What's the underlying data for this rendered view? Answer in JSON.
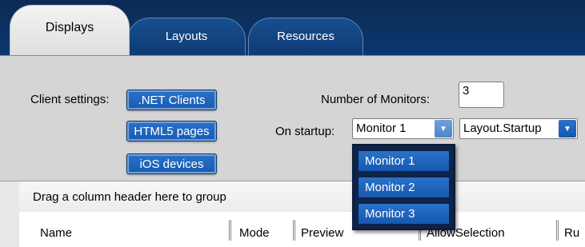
{
  "tabs": [
    {
      "label": "Displays",
      "active": true
    },
    {
      "label": "Layouts",
      "active": false
    },
    {
      "label": "Resources",
      "active": false
    }
  ],
  "client_settings": {
    "label": "Client settings:",
    "buttons": [
      ".NET Clients",
      "HTML5 pages",
      "iOS devices"
    ]
  },
  "monitors": {
    "label": "Number of Monitors:",
    "value": "3"
  },
  "startup": {
    "label": "On startup:",
    "monitor_value": "Monitor 1",
    "layout_value": "Layout.Startup"
  },
  "dropdown": {
    "options": [
      "Monitor 1",
      "Monitor 2",
      "Monitor 3"
    ]
  },
  "grid": {
    "group_hint": "Drag a column header here to group",
    "columns": [
      "Name",
      "Mode",
      "Preview",
      "AllowSelection",
      "Ru"
    ]
  },
  "colors": {
    "tab_strip": "#0d3870",
    "button_blue": "#1f67be",
    "panel_gray": "#d5d5d5"
  }
}
